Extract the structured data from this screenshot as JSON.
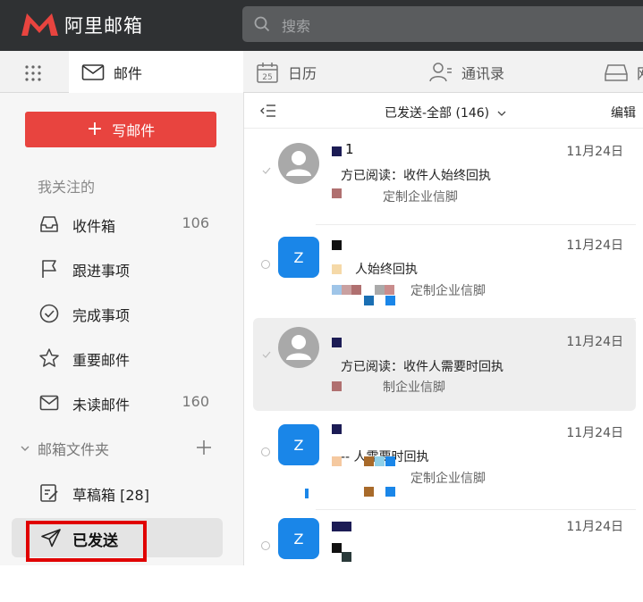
{
  "brand": {
    "name": "阿里邮箱",
    "logo_color": "#e8443f"
  },
  "search": {
    "placeholder": "搜索"
  },
  "tabs": [
    {
      "label": "邮件",
      "icon": "mail-icon",
      "active": true
    },
    {
      "label": "日历",
      "icon": "calendar-icon",
      "day": "25"
    },
    {
      "label": "通讯录",
      "icon": "contacts-icon"
    },
    {
      "label": "网",
      "icon": "drive-icon"
    }
  ],
  "sidebar": {
    "compose_label": "写邮件",
    "favorites_title": "我关注的",
    "items": [
      {
        "label": "收件箱",
        "count": "106",
        "icon": "inbox-icon"
      },
      {
        "label": "跟进事项",
        "count": "",
        "icon": "flag-icon"
      },
      {
        "label": "完成事项",
        "count": "",
        "icon": "check-circle-icon"
      },
      {
        "label": "重要邮件",
        "count": "",
        "icon": "star-icon"
      },
      {
        "label": "未读邮件",
        "count": "160",
        "icon": "envelope-icon"
      }
    ],
    "folders_title": "邮箱文件夹",
    "drafts_label": "草稿箱 [28]",
    "sent_label": "已发送"
  },
  "list": {
    "folder_title": "已发送-全部 (146)",
    "edit_label": "编辑",
    "mails": [
      {
        "sender": "1",
        "date": "11月24日",
        "subject": "方已阅读：收件人始终回执",
        "signature": "定制企业信脚",
        "avatar": "person",
        "selected": false
      },
      {
        "sender": "",
        "date": "11月24日",
        "subject": "人始终回执",
        "signature": "定制企业信脚",
        "avatar": "Z",
        "selected": false
      },
      {
        "sender": "",
        "date": "11月24日",
        "subject": "方已阅读：收件人需要时回执",
        "signature": "制企业信脚",
        "avatar": "person",
        "selected": true
      },
      {
        "sender": "",
        "date": "11月24日",
        "subject": "-- 人需要时回执",
        "signature": "定制企业信脚",
        "avatar": "Z",
        "selected": false
      },
      {
        "sender": "",
        "date": "11月24日",
        "subject": "",
        "signature": "",
        "avatar": "Z",
        "selected": false
      }
    ]
  },
  "colors": {
    "accent": "#e8443f",
    "avatar_blue": "#1a86e8",
    "highlight_box": "#e00000"
  }
}
